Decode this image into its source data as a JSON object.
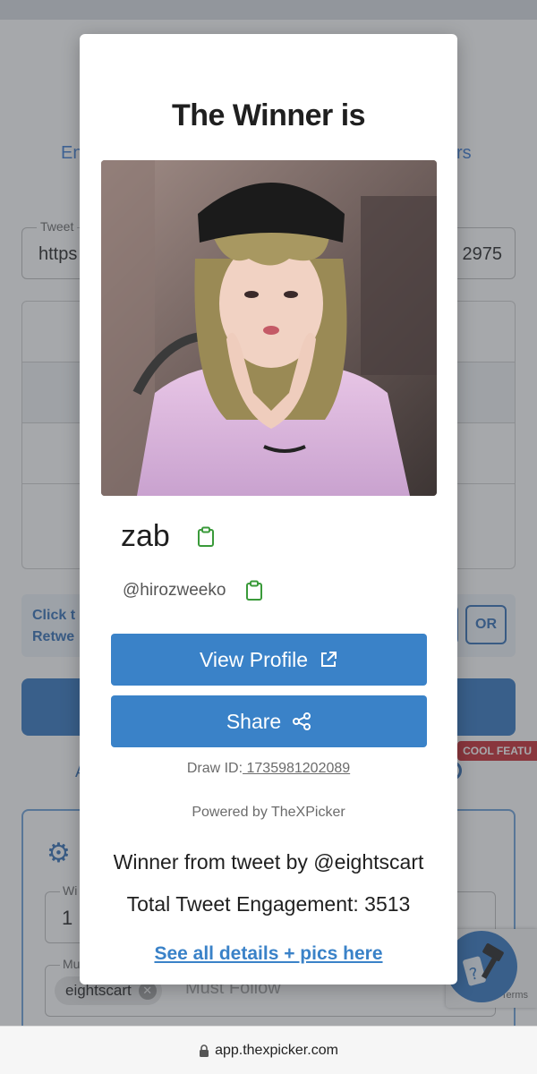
{
  "background": {
    "tab_left": "En",
    "tab_right": "rs",
    "tweet_field_label": "Tweet",
    "tweet_field_value_left": "https",
    "tweet_field_value_right": "2975",
    "click_text_line1": "Click t",
    "click_text_line2": "Retwe",
    "or_label": "OR",
    "cool_feature_badge": "COOL FEATU",
    "a_link": "A",
    "settings_icon": "gear-icon",
    "winners_label": "Wi",
    "winners_value": "1",
    "must_follow_label": "Mu",
    "chip_label": "eightscart",
    "must_follow_placeholder": "Must Follow",
    "terms_text": "Terms"
  },
  "modal": {
    "title": "The Winner is",
    "username": "zab",
    "handle": "@hirozweeko",
    "view_profile_label": "View Profile",
    "share_label": "Share",
    "draw_id_label": "Draw ID:",
    "draw_id_value": " 1735981202089",
    "powered_by": "Powered by TheXPicker",
    "winner_from": "Winner from tweet by @eightscart",
    "engagement": "Total Tweet Engagement: 3513",
    "details_link": "See all details + pics here"
  },
  "browser": {
    "url": "app.thexpicker.com"
  },
  "colors": {
    "accent": "#3a82c8",
    "copy_icon": "#3a9a3a",
    "badge_red": "#c8262d"
  }
}
